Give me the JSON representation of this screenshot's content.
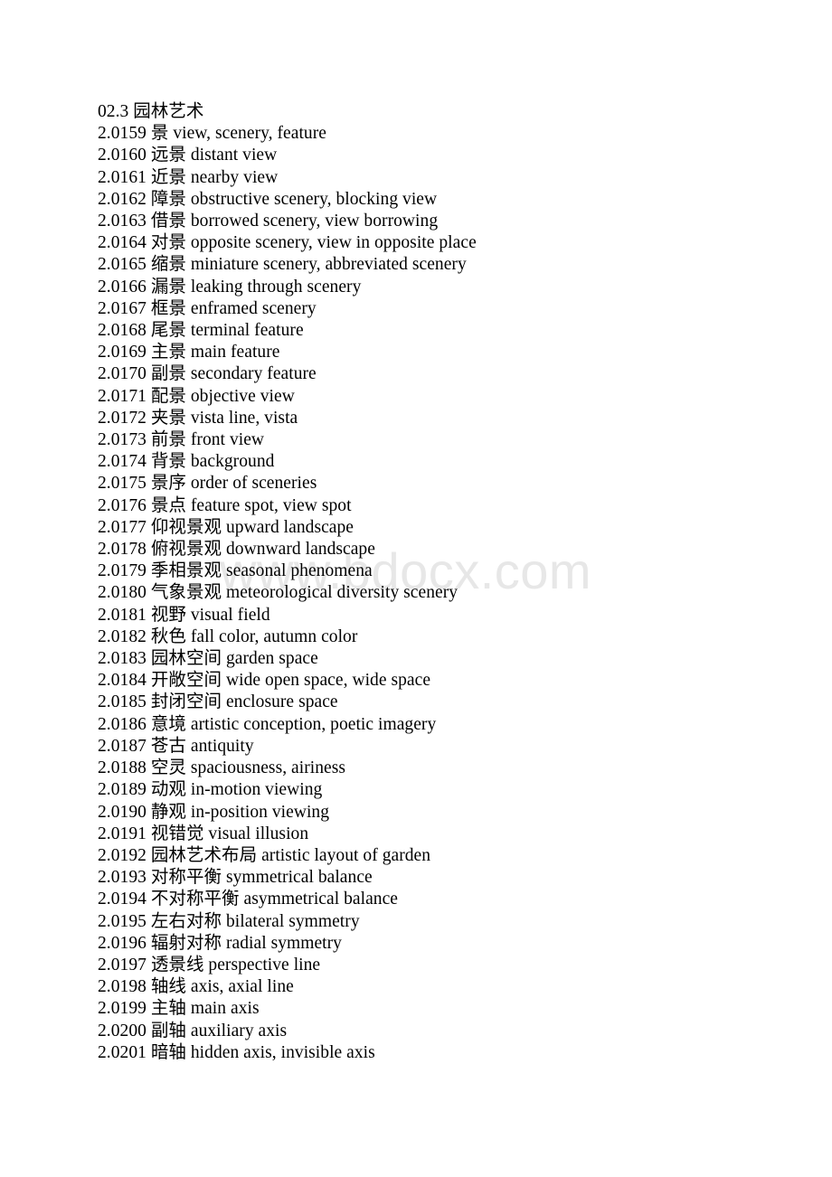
{
  "document": {
    "section_number": "02.3",
    "section_title": "园林艺术",
    "heading_line": "02.3 园林艺术",
    "entries": [
      {
        "id": "2.0159",
        "term_zh": "景",
        "term_en": "view, scenery, feature",
        "line": "2.0159 景 view, scenery, feature"
      },
      {
        "id": "2.0160",
        "term_zh": "远景",
        "term_en": "distant view",
        "line": "2.0160 远景 distant view"
      },
      {
        "id": "2.0161",
        "term_zh": "近景",
        "term_en": "nearby view",
        "line": "2.0161 近景 nearby view"
      },
      {
        "id": "2.0162",
        "term_zh": "障景",
        "term_en": "obstructive scenery, blocking view",
        "line": "2.0162 障景 obstructive scenery, blocking view"
      },
      {
        "id": "2.0163",
        "term_zh": "借景",
        "term_en": "borrowed scenery, view borrowing",
        "line": "2.0163 借景 borrowed scenery, view borrowing"
      },
      {
        "id": "2.0164",
        "term_zh": "对景",
        "term_en": "opposite scenery, view in opposite place",
        "line": "2.0164 对景 opposite scenery, view in opposite place"
      },
      {
        "id": "2.0165",
        "term_zh": "缩景",
        "term_en": "miniature scenery, abbreviated scenery",
        "line": "2.0165 缩景 miniature scenery, abbreviated scenery"
      },
      {
        "id": "2.0166",
        "term_zh": "漏景",
        "term_en": "leaking through scenery",
        "line": "2.0166 漏景 leaking through scenery"
      },
      {
        "id": "2.0167",
        "term_zh": "框景",
        "term_en": "enframed scenery",
        "line": "2.0167 框景 enframed scenery"
      },
      {
        "id": "2.0168",
        "term_zh": "尾景",
        "term_en": "terminal feature",
        "line": "2.0168 尾景 terminal feature"
      },
      {
        "id": "2.0169",
        "term_zh": "主景",
        "term_en": "main feature",
        "line": "2.0169 主景 main feature"
      },
      {
        "id": "2.0170",
        "term_zh": "副景",
        "term_en": "secondary feature",
        "line": "2.0170 副景 secondary feature"
      },
      {
        "id": "2.0171",
        "term_zh": "配景",
        "term_en": "objective view",
        "line": "2.0171 配景 objective view"
      },
      {
        "id": "2.0172",
        "term_zh": "夹景",
        "term_en": "vista line, vista",
        "line": "2.0172 夹景 vista line, vista"
      },
      {
        "id": "2.0173",
        "term_zh": "前景",
        "term_en": "front view",
        "line": "2.0173 前景 front view"
      },
      {
        "id": "2.0174",
        "term_zh": "背景",
        "term_en": "background",
        "line": "2.0174 背景 background"
      },
      {
        "id": "2.0175",
        "term_zh": "景序",
        "term_en": "order of sceneries",
        "line": "2.0175 景序 order of sceneries"
      },
      {
        "id": "2.0176",
        "term_zh": "景点",
        "term_en": "feature spot, view spot",
        "line": "2.0176 景点 feature spot, view spot"
      },
      {
        "id": "2.0177",
        "term_zh": "仰视景观",
        "term_en": "upward landscape",
        "line": "2.0177 仰视景观 upward landscape"
      },
      {
        "id": "2.0178",
        "term_zh": "俯视景观",
        "term_en": "downward landscape",
        "line": "2.0178 俯视景观 downward landscape"
      },
      {
        "id": "2.0179",
        "term_zh": "季相景观",
        "term_en": "seasonal phenomena",
        "line": "2.0179 季相景观 seasonal phenomena"
      },
      {
        "id": "2.0180",
        "term_zh": "气象景观",
        "term_en": "meteorological diversity scenery",
        "line": "2.0180 气象景观 meteorological diversity scenery"
      },
      {
        "id": "2.0181",
        "term_zh": "视野",
        "term_en": "visual field",
        "line": "2.0181 视野 visual field"
      },
      {
        "id": "2.0182",
        "term_zh": "秋色",
        "term_en": "fall color, autumn color",
        "line": "2.0182 秋色 fall color, autumn color"
      },
      {
        "id": "2.0183",
        "term_zh": "园林空间",
        "term_en": "garden space",
        "line": "2.0183 园林空间 garden space"
      },
      {
        "id": "2.0184",
        "term_zh": "开敞空间",
        "term_en": "wide open space, wide space",
        "line": "2.0184 开敞空间 wide open space, wide space"
      },
      {
        "id": "2.0185",
        "term_zh": "封闭空间",
        "term_en": "enclosure space",
        "line": "2.0185 封闭空间 enclosure space"
      },
      {
        "id": "2.0186",
        "term_zh": "意境",
        "term_en": "artistic conception, poetic imagery",
        "line": "2.0186 意境 artistic conception, poetic imagery"
      },
      {
        "id": "2.0187",
        "term_zh": "苍古",
        "term_en": "antiquity",
        "line": "2.0187 苍古 antiquity"
      },
      {
        "id": "2.0188",
        "term_zh": "空灵",
        "term_en": "spaciousness, airiness",
        "line": "2.0188 空灵 spaciousness, airiness"
      },
      {
        "id": "2.0189",
        "term_zh": "动观",
        "term_en": "in-motion viewing",
        "line": "2.0189 动观 in-motion viewing"
      },
      {
        "id": "2.0190",
        "term_zh": "静观",
        "term_en": "in-position viewing",
        "line": "2.0190 静观 in-position viewing"
      },
      {
        "id": "2.0191",
        "term_zh": "视错觉",
        "term_en": "visual illusion",
        "line": "2.0191 视错觉 visual illusion"
      },
      {
        "id": "2.0192",
        "term_zh": "园林艺术布局",
        "term_en": "artistic layout of garden",
        "line": "2.0192 园林艺术布局 artistic layout of garden"
      },
      {
        "id": "2.0193",
        "term_zh": "对称平衡",
        "term_en": "symmetrical balance",
        "line": "2.0193 对称平衡 symmetrical balance"
      },
      {
        "id": "2.0194",
        "term_zh": "不对称平衡",
        "term_en": "asymmetrical balance",
        "line": "2.0194 不对称平衡 asymmetrical balance"
      },
      {
        "id": "2.0195",
        "term_zh": "左右对称",
        "term_en": "bilateral symmetry",
        "line": "2.0195 左右对称 bilateral symmetry"
      },
      {
        "id": "2.0196",
        "term_zh": "辐射对称",
        "term_en": "radial symmetry",
        "line": "2.0196 辐射对称 radial symmetry"
      },
      {
        "id": "2.0197",
        "term_zh": "透景线",
        "term_en": "perspective line",
        "line": "2.0197 透景线 perspective line"
      },
      {
        "id": "2.0198",
        "term_zh": "轴线",
        "term_en": "axis, axial line",
        "line": "2.0198 轴线 axis, axial line"
      },
      {
        "id": "2.0199",
        "term_zh": "主轴",
        "term_en": "main axis",
        "line": "2.0199 主轴 main axis"
      },
      {
        "id": "2.0200",
        "term_zh": "副轴",
        "term_en": "auxiliary axis",
        "line": "2.0200 副轴 auxiliary axis"
      },
      {
        "id": "2.0201",
        "term_zh": "暗轴",
        "term_en": "hidden axis, invisible axis",
        "line": "2.0201 暗轴 hidden axis, invisible axis"
      }
    ]
  },
  "watermark": {
    "text": "www.bdocx.com",
    "color": "#e7e7e7"
  },
  "colors": {
    "page_background": "#ffffff",
    "body_text": "#000000",
    "watermark": "#e7e7e7"
  }
}
